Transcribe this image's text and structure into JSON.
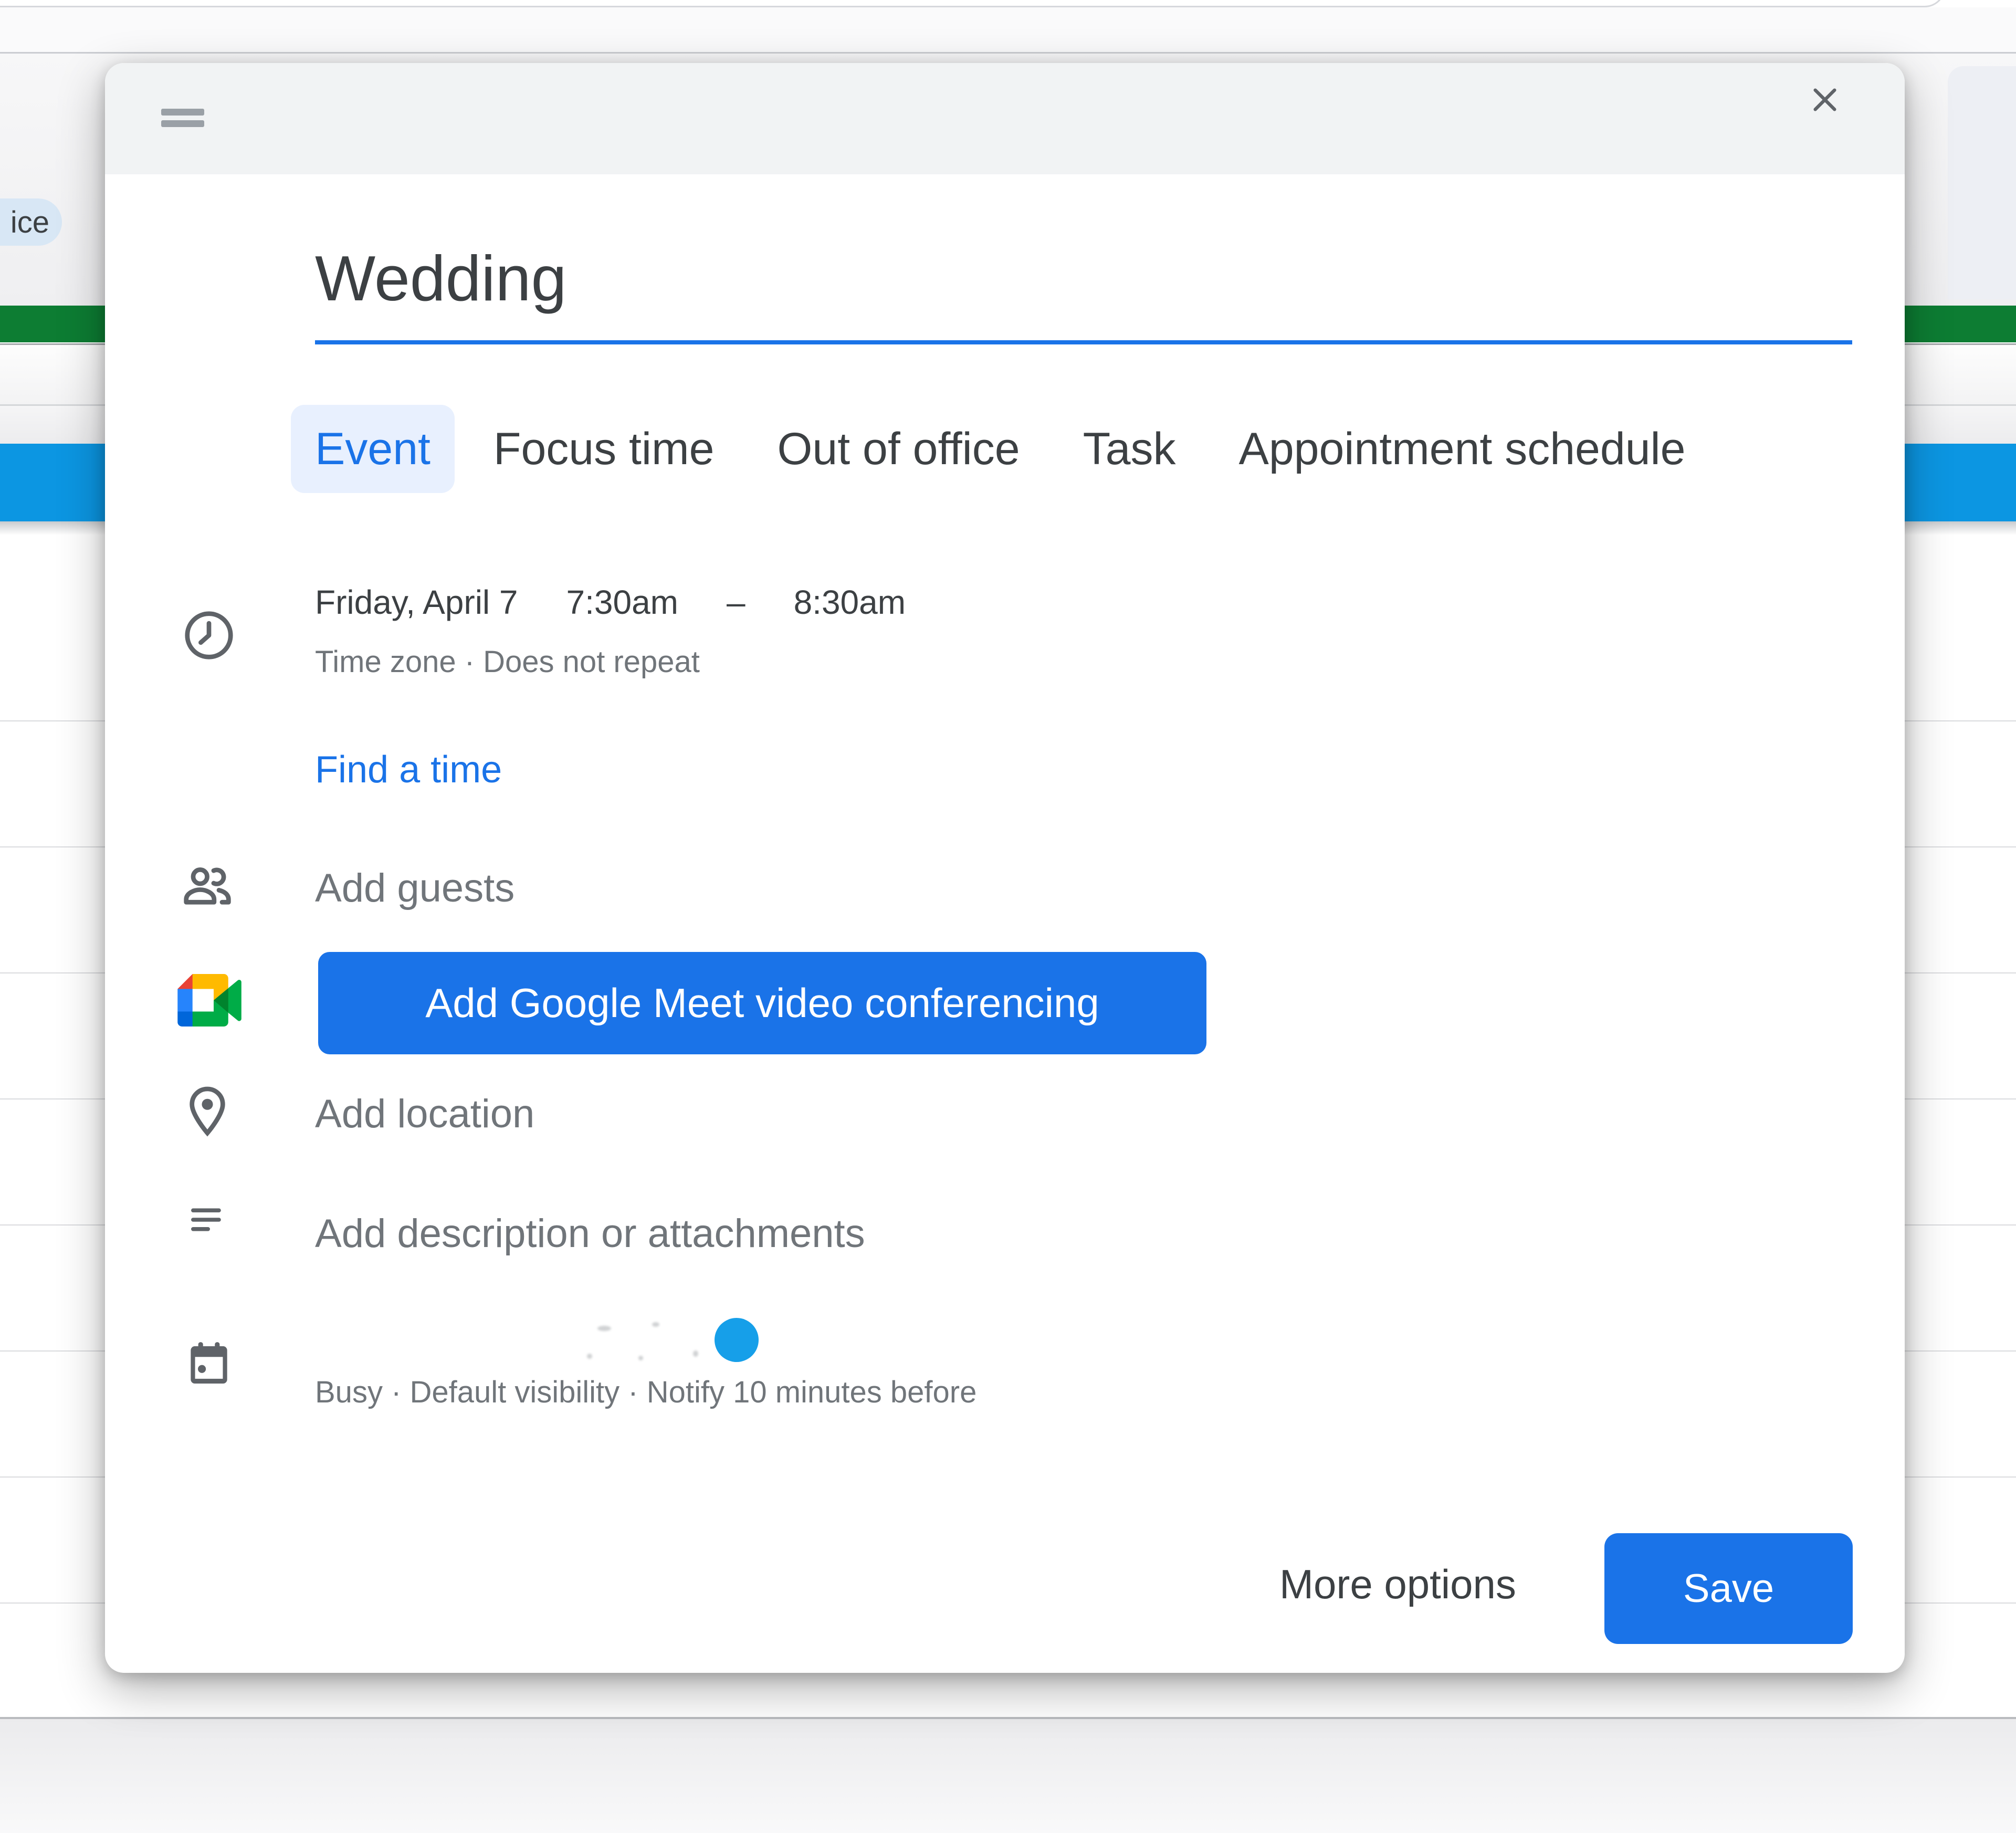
{
  "background": {
    "event_chip_label": "ice"
  },
  "dialog": {
    "title_value": "Wedding",
    "tabs": [
      {
        "label": "Event",
        "active": true
      },
      {
        "label": "Focus time",
        "active": false
      },
      {
        "label": "Out of office",
        "active": false
      },
      {
        "label": "Task",
        "active": false
      },
      {
        "label": "Appointment schedule",
        "active": false
      }
    ],
    "datetime": {
      "date": "Friday, April 7",
      "start_time": "7:30am",
      "dash": "–",
      "end_time": "8:30am",
      "meta": "Time zone · Does not repeat"
    },
    "find_a_time_label": "Find a time",
    "guests_placeholder": "Add guests",
    "meet_button_label": "Add Google Meet video conferencing",
    "location_placeholder": "Add location",
    "description_placeholder": "Add description or attachments",
    "calendar_row": {
      "busy_meta": "Busy · Default visibility · Notify 10 minutes before"
    },
    "footer": {
      "more_options_label": "More options",
      "save_label": "Save"
    }
  },
  "icons": {
    "drag-handle-icon": "=",
    "close-icon": "✕",
    "clock-icon": "clock outline with 7:30 hands",
    "guests-icon": "two people outline",
    "google-meet-icon": "Google Meet camera logo",
    "location-icon": "map pin",
    "description-icon": "three text lines",
    "calendar-icon": "calendar with dot"
  },
  "colors": {
    "accent": "#1a73e8",
    "accent-soft": "#e8f0fe",
    "ink": "#3c4043",
    "muted": "#70757a",
    "icon": "#5f6368",
    "header": "#f1f3f4",
    "green-band": "#0d7d33",
    "blue-band": "#0c96e2",
    "dot": "#169fe9",
    "chip-bg": "#d8e7f5"
  }
}
